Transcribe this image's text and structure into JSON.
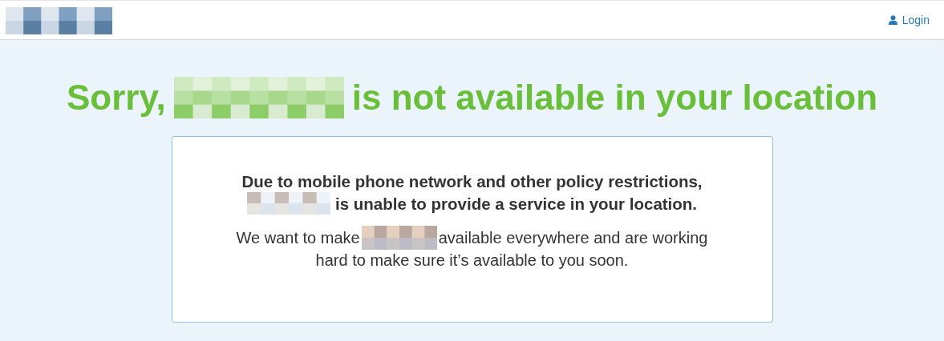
{
  "header": {
    "login": "Login"
  },
  "title": {
    "before": "Sorry,",
    "after": "is not available in your location"
  },
  "notice": {
    "restriction_before": "Due to mobile phone network and other policy restrictions,",
    "restriction_after": "is unable to provide a service in your location.",
    "message_before": "We want to make",
    "message_after": "available everywhere and are working",
    "message_end": "hard to make sure it’s available to you soon."
  }
}
